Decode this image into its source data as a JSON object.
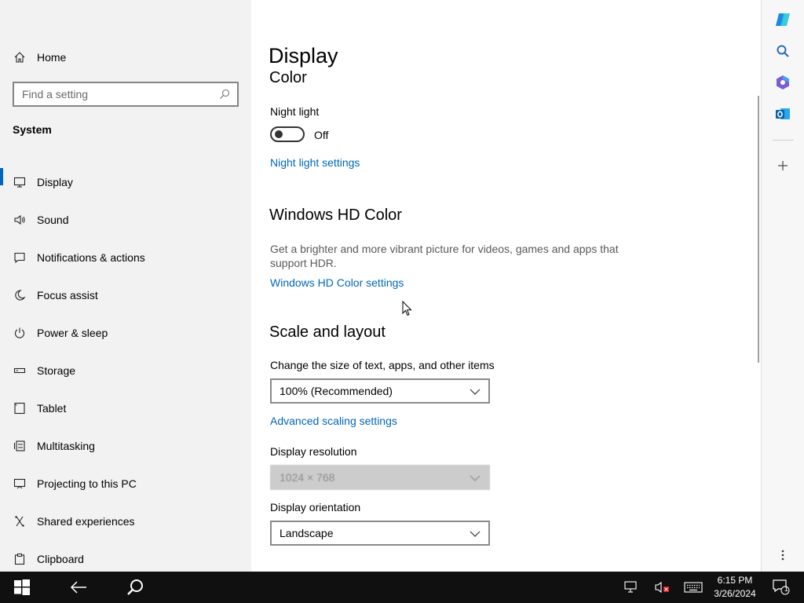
{
  "sidebar": {
    "home_label": "Home",
    "search_placeholder": "Find a setting",
    "section_title": "System",
    "items": [
      {
        "label": "Display",
        "icon": "monitor-icon",
        "selected": true
      },
      {
        "label": "Sound",
        "icon": "speaker-icon"
      },
      {
        "label": "Notifications & actions",
        "icon": "notification-icon"
      },
      {
        "label": "Focus assist",
        "icon": "moon-icon"
      },
      {
        "label": "Power & sleep",
        "icon": "power-icon"
      },
      {
        "label": "Storage",
        "icon": "storage-icon"
      },
      {
        "label": "Tablet",
        "icon": "tablet-icon"
      },
      {
        "label": "Multitasking",
        "icon": "multitasking-icon"
      },
      {
        "label": "Projecting to this PC",
        "icon": "projecting-icon"
      },
      {
        "label": "Shared experiences",
        "icon": "shared-experiences-icon"
      },
      {
        "label": "Clipboard",
        "icon": "clipboard-icon"
      }
    ]
  },
  "main": {
    "page_title": "Display",
    "color_heading": "Color",
    "night_light_label": "Night light",
    "night_light_state": "Off",
    "night_light_link": "Night light settings",
    "hd_heading": "Windows HD Color",
    "hd_desc": "Get a brighter and more vibrant picture for videos, games and apps that support HDR.",
    "hd_link": "Windows HD Color settings",
    "scale_heading": "Scale and layout",
    "scale_label": "Change the size of text, apps, and other items",
    "scale_value": "100% (Recommended)",
    "advanced_scaling_link": "Advanced scaling settings",
    "resolution_label": "Display resolution",
    "resolution_value": "1024 × 768",
    "orientation_label": "Display orientation",
    "orientation_value": "Landscape"
  },
  "rail": {
    "icons": [
      "copilot-icon",
      "search-icon",
      "m365-icon",
      "outlook-icon",
      "add-icon",
      "more-icon"
    ]
  },
  "taskbar": {
    "time": "6:15 PM",
    "date": "3/26/2024",
    "notification_count": "1"
  },
  "colors": {
    "accent": "#0067c0",
    "link": "#0067b8",
    "sidebar_bg": "#f2f2f2",
    "taskbar_bg": "#101010"
  }
}
